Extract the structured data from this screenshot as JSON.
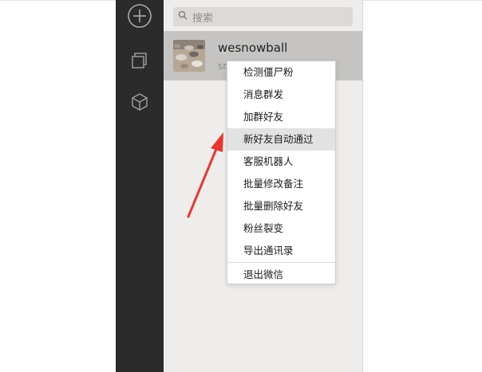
{
  "search": {
    "placeholder": "搜索"
  },
  "sidebar": {
    "icons": [
      "add-icon",
      "copy-icon",
      "box-icon"
    ]
  },
  "contact": {
    "name": "wesnowball",
    "subtitle": "sn"
  },
  "menu": {
    "items": [
      "检测僵尸粉",
      "消息群发",
      "加群好友",
      "新好友自动通过",
      "客服机器人",
      "批量修改备注",
      "批量删除好友",
      "粉丝裂变",
      "导出通讯录",
      "退出微信"
    ],
    "highlighted_index": 3
  },
  "colors": {
    "sidebar": "#2b2b2b",
    "panel": "#efedeb",
    "selected_row": "#c5c4c3",
    "arrow": "#e8362f"
  }
}
